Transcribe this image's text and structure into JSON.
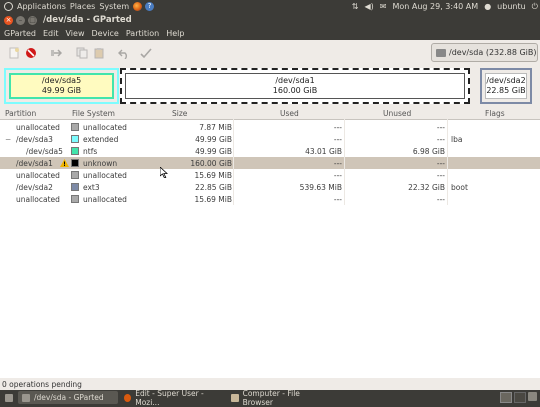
{
  "topbar": {
    "menus": [
      "Applications",
      "Places",
      "System"
    ],
    "datetime": "Mon Aug 29,  3:40 AM",
    "user": "ubuntu"
  },
  "window": {
    "title": "/dev/sda - GParted"
  },
  "menubar": [
    "GParted",
    "Edit",
    "View",
    "Device",
    "Partition",
    "Help"
  ],
  "device_selector": {
    "label": "/dev/sda   (232.88 GiB)"
  },
  "diskmap": [
    {
      "name": "/dev/sda5",
      "size": "49.99 GiB"
    },
    {
      "name": "/dev/sda1",
      "size": "160.00 GiB"
    },
    {
      "name": "/dev/sda2",
      "size": "22.85 GiB"
    }
  ],
  "table": {
    "headers": [
      "Partition",
      "File System",
      "Size",
      "Used",
      "Unused",
      "Flags"
    ],
    "rows": [
      {
        "partition": "unallocated",
        "fs": "unallocated",
        "size": "7.87 MiB",
        "used": "---",
        "unused": "---",
        "flags": "",
        "color": "#a9a9a9"
      },
      {
        "partition": "/dev/sda3",
        "fs": "extended",
        "size": "49.99 GiB",
        "used": "---",
        "unused": "---",
        "flags": "lba",
        "color": "#7dfcfe"
      },
      {
        "partition": "/dev/sda5",
        "fs": "ntfs",
        "size": "49.99 GiB",
        "used": "43.01 GiB",
        "unused": "6.98 GiB",
        "flags": "",
        "color": "#42e5ac"
      },
      {
        "partition": "/dev/sda1",
        "fs": "unknown",
        "size": "160.00 GiB",
        "used": "---",
        "unused": "---",
        "flags": "",
        "color": "#000000"
      },
      {
        "partition": "unallocated",
        "fs": "unallocated",
        "size": "15.69 MiB",
        "used": "---",
        "unused": "---",
        "flags": "",
        "color": "#a9a9a9"
      },
      {
        "partition": "/dev/sda2",
        "fs": "ext3",
        "size": "22.85 GiB",
        "used": "539.63 MiB",
        "unused": "22.32 GiB",
        "flags": "boot",
        "color": "#7d8aa6"
      },
      {
        "partition": "unallocated",
        "fs": "unallocated",
        "size": "15.69 MiB",
        "used": "---",
        "unused": "---",
        "flags": "",
        "color": "#a9a9a9"
      }
    ]
  },
  "status": "0 operations pending",
  "taskbar": [
    {
      "label": "/dev/sda - GParted",
      "active": true
    },
    {
      "label": "Edit - Super User - Mozi...",
      "active": false
    },
    {
      "label": "Computer - File Browser",
      "active": false
    }
  ],
  "colors": {
    "accent": "#e95420",
    "panel": "#3c3b37",
    "selected_row": "#cfc5b8"
  }
}
